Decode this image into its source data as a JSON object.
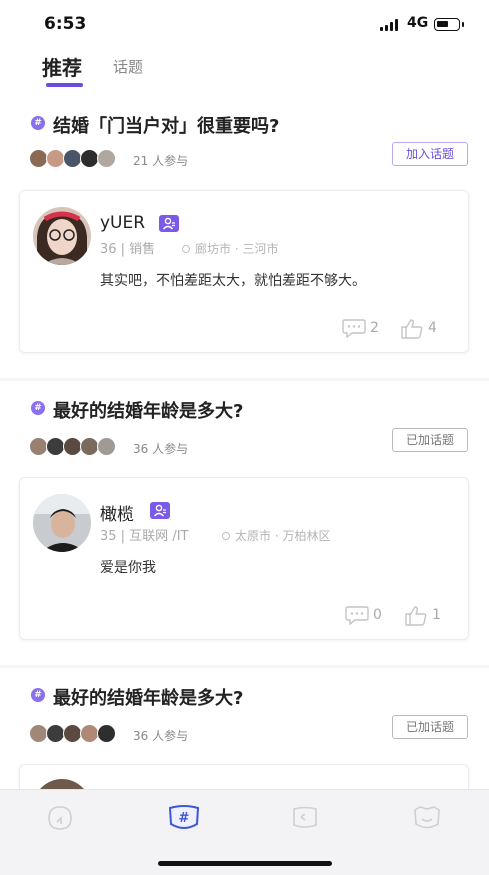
{
  "status_bar": {
    "time": "6:53",
    "network": "4G",
    "battery_level": 0.55
  },
  "header": {
    "tabs": [
      {
        "label": "推荐",
        "active": true
      },
      {
        "label": "话题",
        "active": false
      }
    ],
    "accent_color": "#6a4de0"
  },
  "feed": [
    {
      "topic_title": "结婚「门当户对」很重要吗?",
      "participants": "21 人参与",
      "join_label": "加入话题",
      "joined": false,
      "post": {
        "author": "yUER",
        "meta": "36 | 销售",
        "location": "廊坊市 · 三河市",
        "body": "其实吧，不怕差距太大，就怕差距不够大。",
        "comments": "2",
        "likes": "4"
      }
    },
    {
      "topic_title": "最好的结婚年龄是多大?",
      "participants": "36 人参与",
      "join_label": "已加话题",
      "joined": true,
      "post": {
        "author": "橄榄",
        "meta": "35 | 互联网 /IT",
        "location": "太原市 · 万柏林区",
        "body": "爱是你我",
        "comments": "0",
        "likes": "1"
      }
    },
    {
      "topic_title": "最好的结婚年龄是多大?",
      "participants": "36 人参与",
      "join_label": "已加话题",
      "joined": true
    }
  ],
  "tab_bar": {
    "items": [
      {
        "icon": "home-icon",
        "active": false
      },
      {
        "icon": "topic-hash-icon",
        "active": true
      },
      {
        "icon": "message-icon",
        "active": false
      },
      {
        "icon": "profile-face-icon",
        "active": false
      }
    ]
  }
}
